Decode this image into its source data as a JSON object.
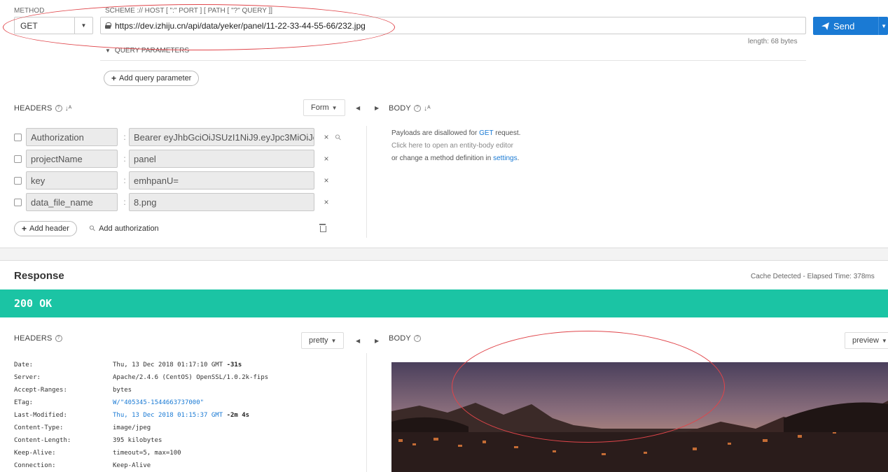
{
  "request": {
    "method_label": "METHOD",
    "url_hint": "SCHEME :// HOST [ \":\" PORT ] [ PATH [ \"?\" QUERY ]]",
    "method": "GET",
    "url": "https://dev.izhiju.cn/api/data/yeker/panel/11-22-33-44-55-66/232.jpg",
    "send_label": "Send",
    "length_text": "length: 68 bytes",
    "query_toggle": "QUERY PARAMETERS",
    "add_query_label": "Add query parameter"
  },
  "headers_section": {
    "title": "HEADERS",
    "form_label": "Form",
    "rows": [
      {
        "key": "Authorization",
        "value": "Bearer eyJhbGciOiJSUzI1NiJ9.eyJpc3MiOiJo"
      },
      {
        "key": "projectName",
        "value": "panel"
      },
      {
        "key": "key",
        "value": "emhpanU="
      },
      {
        "key": "data_file_name",
        "value": "8.png"
      }
    ],
    "add_header_label": "Add header",
    "add_auth_label": "Add authorization"
  },
  "body_section": {
    "title": "BODY",
    "line1_prefix": "Payloads are disallowed for ",
    "line1_method": "GET",
    "line1_suffix": " request.",
    "line2": "Click here to open an entity-body editor",
    "line3_prefix": "or change a method definition in ",
    "line3_link": "settings",
    "line3_suffix": "."
  },
  "response": {
    "title": "Response",
    "elapsed": "Cache Detected - Elapsed Time: 378ms",
    "status": "200 OK",
    "headers_title": "HEADERS",
    "pretty_label": "pretty",
    "body_title": "BODY",
    "preview_label": "preview",
    "headers": [
      {
        "key": "Date:",
        "value": "Thu, 13 Dec 2018 01:17:10 GMT",
        "extra": "-31s"
      },
      {
        "key": "Server:",
        "value": "Apache/2.4.6 (CentOS) OpenSSL/1.0.2k-fips",
        "extra": ""
      },
      {
        "key": "Accept-Ranges:",
        "value": "bytes",
        "extra": ""
      },
      {
        "key": "ETag:",
        "value": "W/\"405345-1544663737000\"",
        "extra": ""
      },
      {
        "key": "Last-Modified:",
        "value": "Thu, 13 Dec 2018 01:15:37 GMT",
        "extra": "-2m 4s"
      },
      {
        "key": "Content-Type:",
        "value": "image/jpeg",
        "extra": ""
      },
      {
        "key": "Content-Length:",
        "value": "395 kilobytes",
        "extra": ""
      },
      {
        "key": "Keep-Alive:",
        "value": "timeout=5, max=100",
        "extra": ""
      },
      {
        "key": "Connection:",
        "value": "Keep-Alive",
        "extra": ""
      }
    ]
  },
  "colors": {
    "accent": "#1a7ad4",
    "status_ok": "#1bc4a4",
    "annotation": "#e0454a"
  }
}
